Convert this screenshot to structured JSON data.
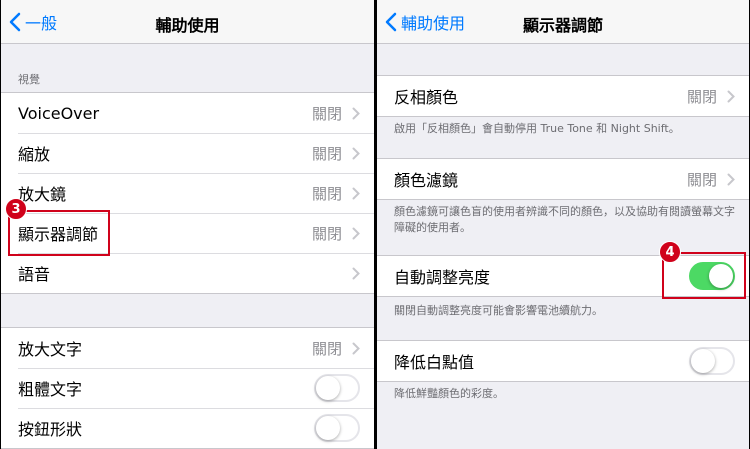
{
  "left": {
    "nav": {
      "back_label": "一般",
      "title": "輔助使用"
    },
    "section_vision": "視覺",
    "group1": [
      {
        "label": "VoiceOver",
        "value": "關閉"
      },
      {
        "label": "縮放",
        "value": "關閉"
      },
      {
        "label": "放大鏡",
        "value": "關閉"
      },
      {
        "label": "顯示器調節",
        "value": "關閉"
      },
      {
        "label": "語音",
        "value": ""
      }
    ],
    "group2": {
      "larger_text": {
        "label": "放大文字",
        "value": "關閉"
      },
      "bold_text": {
        "label": "粗體文字",
        "on": false
      },
      "button_shapes": {
        "label": "按鈕形狀",
        "on": false
      }
    }
  },
  "right": {
    "nav": {
      "back_label": "輔助使用",
      "title": "顯示器調節"
    },
    "invert": {
      "label": "反相顏色",
      "value": "關閉",
      "footer": "啟用「反相顏色」會自動停用 True Tone 和 Night Shift。"
    },
    "filters": {
      "label": "顏色濾鏡",
      "value": "關閉",
      "footer": "顏色濾鏡可讓色盲的使用者辨識不同的顏色，以及協助有閱讀螢幕文字障礙的使用者。"
    },
    "auto_brightness": {
      "label": "自動調整亮度",
      "on": true,
      "footer": "關閉自動調整亮度可能會影響電池續航力。"
    },
    "white_point": {
      "label": "降低白點值",
      "on": false,
      "footer": "降低鮮豔顏色的彩度。"
    }
  },
  "annotations": {
    "step3": "3",
    "step4": "4",
    "color": "#d0021b"
  },
  "colors": {
    "accent": "#007aff",
    "toggle_on": "#4cd964"
  }
}
